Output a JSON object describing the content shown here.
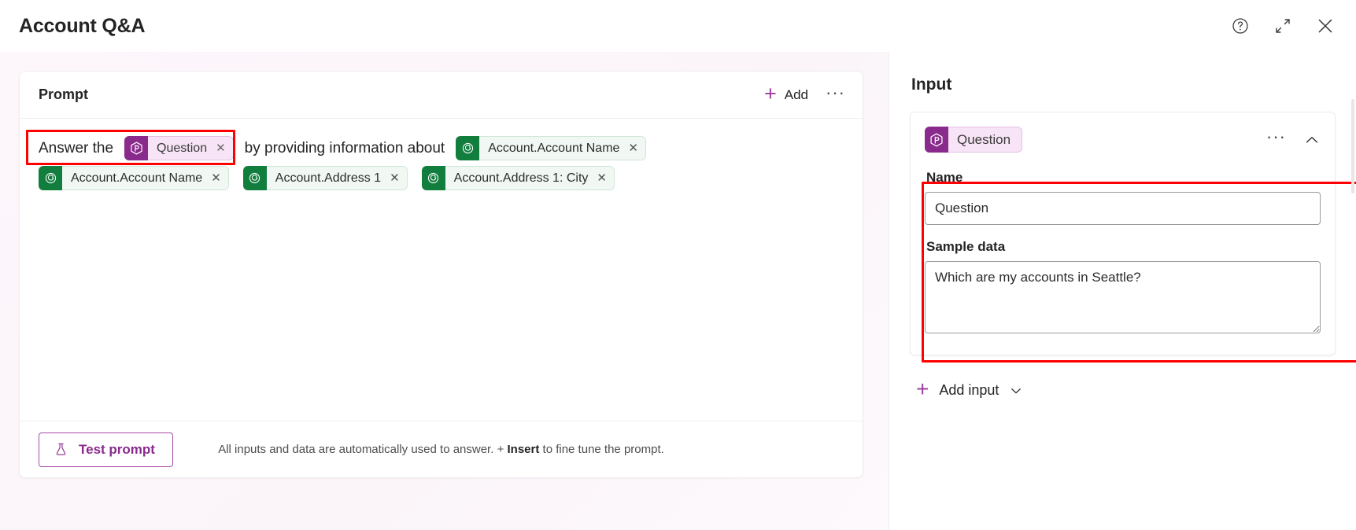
{
  "header": {
    "title": "Account Q&A",
    "actions": [
      {
        "name": "help-icon",
        "label": "Help"
      },
      {
        "name": "expand-icon",
        "label": "Expand"
      },
      {
        "name": "close-icon",
        "label": "Close"
      }
    ]
  },
  "prompt": {
    "section_label": "Prompt",
    "add_label": "Add",
    "plus": "+",
    "more_label": "···",
    "line1": {
      "text_before": "Answer the",
      "text_after": "by providing information about"
    },
    "tokens": [
      {
        "label": "Question",
        "type": "input",
        "close": "✕"
      },
      {
        "label": "Account.Account Name",
        "type": "data",
        "close": "✕"
      },
      {
        "label": "Account.Account Name",
        "type": "data",
        "close": "✕"
      },
      {
        "label": "Account.Address 1",
        "type": "data",
        "close": "✕"
      },
      {
        "label": "Account.Address 1: City",
        "type": "data",
        "close": "✕"
      }
    ],
    "test_button": "Test prompt",
    "footer_note_prefix": "All inputs and data are automatically used to answer. + ",
    "footer_note_bold": "Insert",
    "footer_note_suffix": " to fine tune the prompt."
  },
  "input_panel": {
    "title": "Input",
    "chip_label": "Question",
    "more_label": "···",
    "name_label": "Name",
    "name_value": "Question",
    "sample_label": "Sample data",
    "sample_value": "Which are my accounts in Seattle?",
    "add_input_label": "Add input",
    "plus": "+"
  },
  "colors": {
    "accent_purple": "#8a2a8c",
    "chip_purple_bg": "#f7e4f6",
    "chip_green_icon": "#127e3e",
    "chip_green_bg": "#f1f8f3",
    "highlight_red": "#ff0000"
  }
}
